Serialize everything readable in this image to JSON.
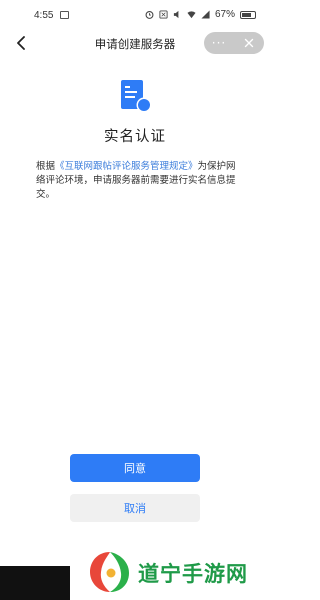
{
  "status_bar": {
    "time": "4:55",
    "battery_percent": "67%",
    "icons": [
      "image-icon",
      "alarm-icon",
      "nfc-icon",
      "volume-icon",
      "wifi-icon",
      "signal-icon",
      "battery-icon"
    ]
  },
  "nav": {
    "title": "申请创建服务器",
    "more_label": "···",
    "icons": {
      "back": "chevron-left-icon",
      "close": "close-icon"
    }
  },
  "content": {
    "icon": "document-badge-icon",
    "title": "实名认证",
    "desc_prefix": "根据",
    "desc_link": "《互联网跟帖评论服务管理规定》",
    "desc_suffix": "为保护网络评论环境，申请服务器前需要进行实名信息提交。"
  },
  "actions": {
    "confirm_label": "同意",
    "cancel_label": "取消"
  },
  "watermark": {
    "text": "道宁手游网"
  },
  "colors": {
    "accent": "#2e7cf6",
    "link": "#3b7ddb",
    "watermark_green": "#1f9a48"
  }
}
